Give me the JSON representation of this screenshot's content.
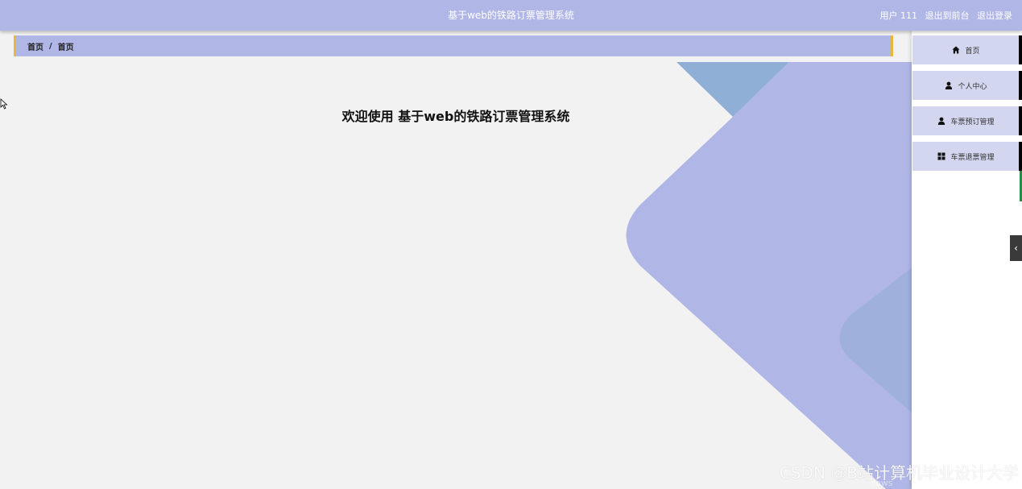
{
  "header": {
    "title": "基于web的铁路订票管理系统",
    "user_label": "用户 111",
    "back_to_front": "退出到前台",
    "logout": "退出登录"
  },
  "breadcrumb": {
    "items": [
      "首页",
      "首页"
    ],
    "separator": "/"
  },
  "main": {
    "welcome": "欢迎使用 基于web的铁路订票管理系统"
  },
  "sidebar": {
    "items": [
      {
        "label": "首页",
        "icon": "home-icon"
      },
      {
        "label": "个人中心",
        "icon": "user-icon"
      },
      {
        "label": "车票预订管理",
        "icon": "user-icon"
      },
      {
        "label": "车票退票管理",
        "icon": "grid-icon"
      }
    ],
    "collapse_icon": "chevron-left-icon"
  },
  "overlay": {
    "watermark": "CSDN @B站计算机毕业设计大学",
    "ghost_text": "dows"
  },
  "colors": {
    "accent": "#b0b7e6",
    "breadcrumb_border": "#e8b83c",
    "menu_item_bg": "#d2d6ee",
    "deco_blue": "#8fafd6"
  }
}
